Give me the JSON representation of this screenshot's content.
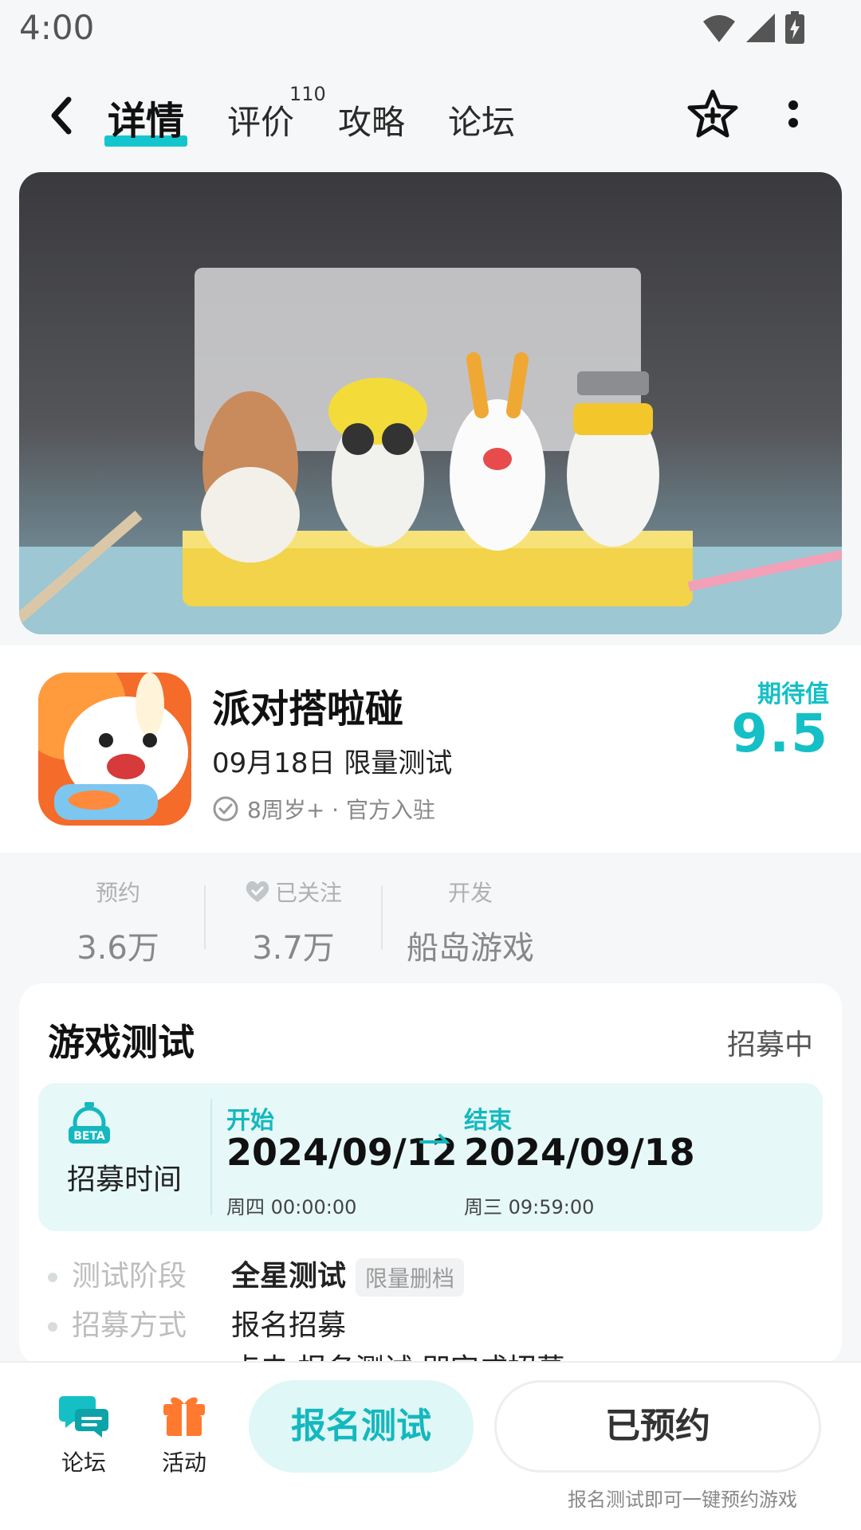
{
  "status_bar": {
    "time": "4:00"
  },
  "nav": {
    "tabs": [
      {
        "label": "详情",
        "active": true
      },
      {
        "label": "评价",
        "badge": "110"
      },
      {
        "label": "攻略"
      },
      {
        "label": "论坛"
      }
    ]
  },
  "game": {
    "title": "派对搭啦碰",
    "date_line": "09月18日 限量测试",
    "meta": "8周岁+ · 官方入驻",
    "expect_label": "期待值",
    "expect_value": "9.5"
  },
  "stats": [
    {
      "label": "预约",
      "value": "3.6万"
    },
    {
      "label": "已关注",
      "value": "3.7万"
    },
    {
      "label": "开发",
      "value": "船岛游戏"
    }
  ],
  "test_card": {
    "title": "游戏测试",
    "status": "招募中",
    "recruit_label": "招募时间",
    "start": {
      "head": "开始",
      "date": "2024/09/12",
      "sub": "周四  00:00:00"
    },
    "end": {
      "head": "结束",
      "date": "2024/09/18",
      "sub": "周三  09:59:00"
    },
    "rows": [
      {
        "key": "测试阶段",
        "value": "全星测试",
        "chip": "限量删档"
      },
      {
        "key": "招募方式",
        "value": "报名招募"
      }
    ],
    "partial_line": "点击 报名测试 即完成招募"
  },
  "bottom_bar": {
    "forum_label": "论坛",
    "activity_label": "活动",
    "signup_button": "报名测试",
    "booked_button": "已预约",
    "hint": "报名测试即可一键预约游戏"
  },
  "colors": {
    "accent": "#14c0c6",
    "accent_bg": "#e6f8f8",
    "activity_icon": "#ff7a2f"
  }
}
